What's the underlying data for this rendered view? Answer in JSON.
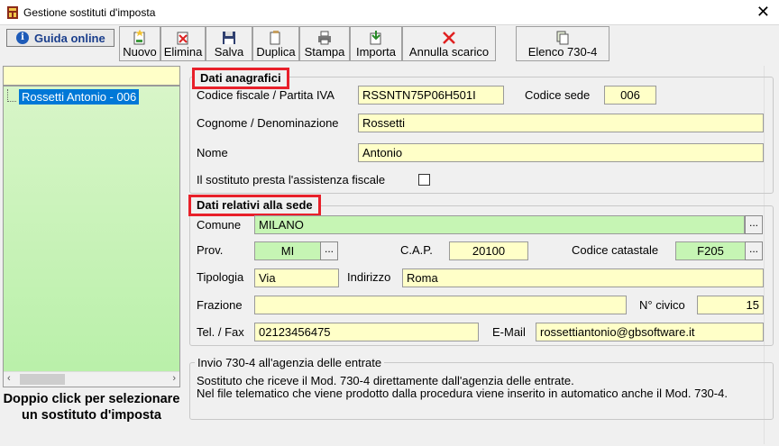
{
  "window": {
    "title": "Gestione sostituti d'imposta",
    "close": "✕"
  },
  "toolbar": {
    "guide_label": "Guida online",
    "buttons": [
      {
        "label": "Nuovo"
      },
      {
        "label": "Elimina"
      },
      {
        "label": "Salva"
      },
      {
        "label": "Duplica"
      },
      {
        "label": "Stampa"
      },
      {
        "label": "Importa"
      },
      {
        "label": "Annulla scarico"
      },
      {
        "label": "Elenco 730-4"
      }
    ]
  },
  "left": {
    "items": [
      {
        "label": "Rossetti Antonio - 006"
      }
    ],
    "hint": "Doppio click per selezionare un sostituto d'imposta"
  },
  "anagrafici": {
    "legend": "Dati anagrafici",
    "cf_label": "Codice fiscale / Partita IVA",
    "cf_value": "RSSNTN75P06H501I",
    "sede_label": "Codice sede",
    "sede_value": "006",
    "cognome_label": "Cognome / Denominazione",
    "cognome_value": "Rossetti",
    "nome_label": "Nome",
    "nome_value": "Antonio",
    "assistenza_label": "Il sostituto presta l'assistenza fiscale",
    "assistenza_checked": false
  },
  "sede": {
    "legend": "Dati relativi alla sede",
    "comune_label": "Comune",
    "comune_value": "MILANO",
    "prov_label": "Prov.",
    "prov_value": "MI",
    "cap_label": "C.A.P.",
    "cap_value": "20100",
    "catastale_label": "Codice catastale",
    "catastale_value": "F205",
    "tipologia_label": "Tipologia",
    "tipologia_value": "Via",
    "indirizzo_label": "Indirizzo",
    "indirizzo_value": "Roma",
    "frazione_label": "Frazione",
    "frazione_value": "",
    "civico_label": "N° civico",
    "civico_value": "15",
    "tel_label": "Tel. / Fax",
    "tel_value": "02123456475",
    "email_label": "E-Mail",
    "email_value": "rossettiantonio@gbsoftware.it",
    "dots": "..."
  },
  "invio": {
    "legend": "Invio 730-4 all'agenzia delle entrate",
    "line1": "Sostituto che riceve il Mod. 730-4 direttamente dall'agenzia delle entrate.",
    "line2": "Nel file telematico che viene prodotto dalla procedura viene inserito in automatico anche il Mod. 730-4."
  },
  "colors": {
    "yellow_field": "#ffffc8",
    "green_field": "#c6f5b4",
    "highlight": "#e8202a",
    "selection": "#0078d7"
  }
}
